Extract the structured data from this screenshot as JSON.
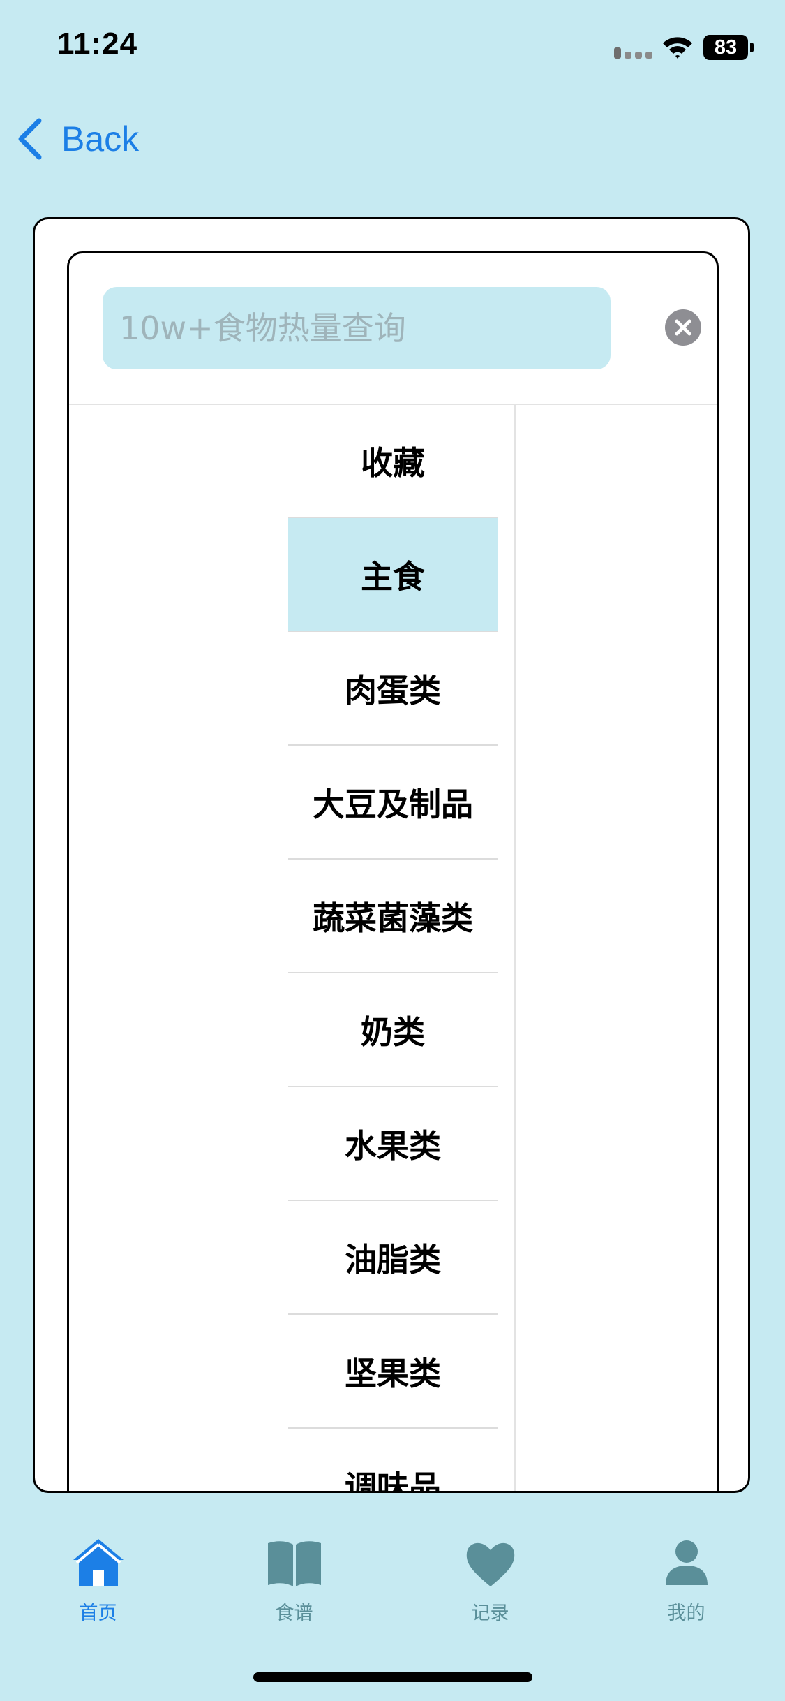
{
  "status_bar": {
    "time": "11:24",
    "battery": "83"
  },
  "nav": {
    "back_label": "Back"
  },
  "search": {
    "placeholder": "10w+食物热量查询",
    "value": ""
  },
  "categories": {
    "selected_index": 1,
    "items": [
      {
        "label": "收藏"
      },
      {
        "label": "主食"
      },
      {
        "label": "肉蛋类"
      },
      {
        "label": "大豆及制品"
      },
      {
        "label": "蔬菜菌藻类"
      },
      {
        "label": "奶类"
      },
      {
        "label": "水果类"
      },
      {
        "label": "油脂类"
      },
      {
        "label": "坚果类"
      },
      {
        "label": "调味品"
      }
    ]
  },
  "tab_bar": {
    "items": [
      {
        "label": "首页",
        "icon": "home-icon",
        "active": true
      },
      {
        "label": "食谱",
        "icon": "book-icon",
        "active": false
      },
      {
        "label": "记录",
        "icon": "heart-icon",
        "active": false
      },
      {
        "label": "我的",
        "icon": "person-icon",
        "active": false
      }
    ]
  },
  "colors": {
    "background": "#c6eaf2",
    "accent": "#1c7fe6",
    "tab_inactive": "#5a8f99",
    "selected_row": "#c6eaf2"
  }
}
